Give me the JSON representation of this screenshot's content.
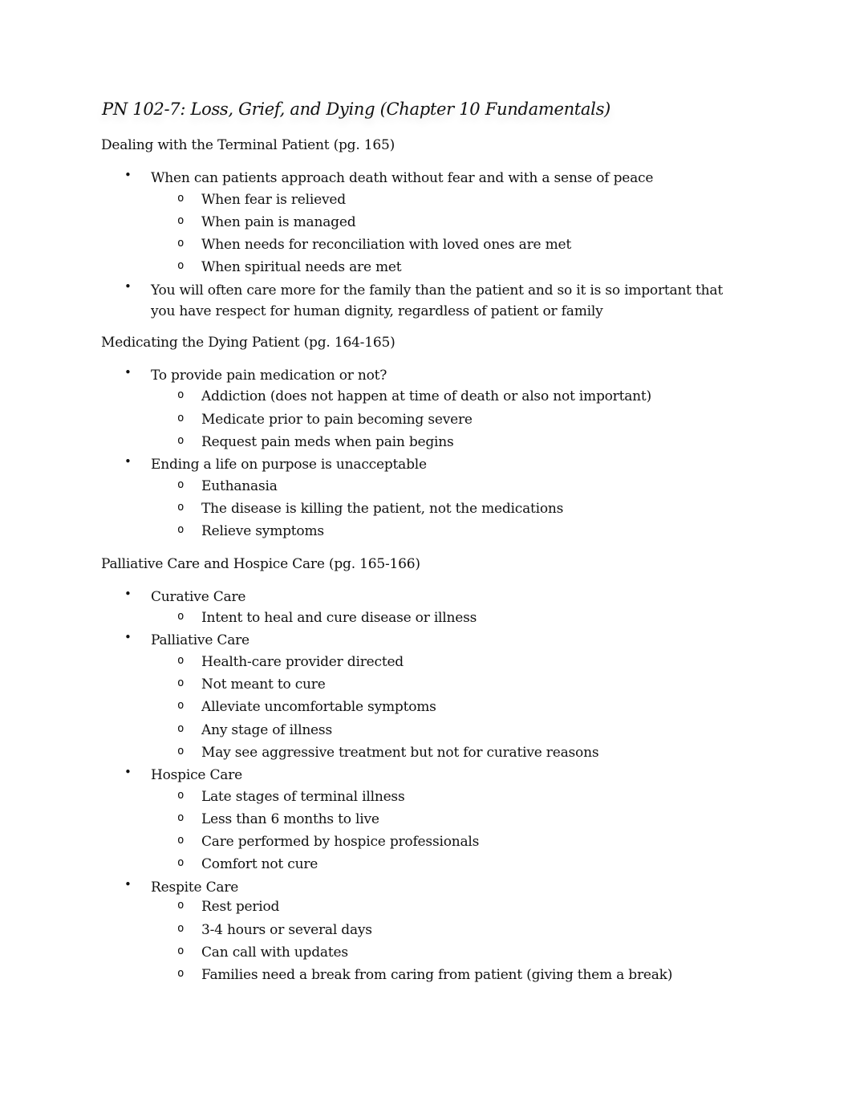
{
  "document": {
    "title": "PN 102-7: Loss, Grief, and Dying (Chapter 10 Fundamentals)",
    "bullet_glyph": "•",
    "sub_bullet_glyph": "o",
    "sections": [
      {
        "heading": "Dealing with the Terminal Patient (pg. 165)",
        "items": [
          {
            "text": "When can patients approach death without fear and with a sense of peace",
            "subitems": [
              "When fear is relieved",
              "When pain is managed",
              "When needs for reconciliation with loved ones are met",
              "When spiritual needs are met"
            ]
          },
          {
            "text_line1": "You will often care more for the family than the patient and so it is so important that",
            "text_line2": "you have respect for human dignity, regardless of patient or family",
            "subitems": []
          }
        ]
      },
      {
        "heading": "Medicating the Dying Patient (pg. 164-165)",
        "items": [
          {
            "text": "To provide pain medication or not?",
            "subitems": [
              "Addiction (does not happen at time of death or also not important)",
              "Medicate prior to pain becoming severe",
              "Request pain meds when pain begins"
            ]
          },
          {
            "text": "Ending a life on purpose is unacceptable",
            "subitems": [
              "Euthanasia",
              "The disease is killing the patient, not the medications",
              "Relieve symptoms"
            ]
          }
        ]
      },
      {
        "heading": "Palliative Care and Hospice Care (pg. 165-166)",
        "items": [
          {
            "text": "Curative Care",
            "subitems": [
              "Intent to heal and cure disease or illness"
            ]
          },
          {
            "text": "Palliative Care",
            "subitems": [
              "Health-care provider directed",
              "Not meant to cure",
              "Alleviate uncomfortable symptoms",
              "Any stage of illness",
              "May see aggressive treatment but not for curative reasons"
            ]
          },
          {
            "text": "Hospice Care",
            "subitems": [
              "Late stages of terminal illness",
              "Less than 6 months to live",
              "Care performed by hospice professionals",
              "Comfort not cure"
            ]
          },
          {
            "text": "Respite Care",
            "subitems": [
              "Rest period",
              "3-4 hours or several days",
              "Can call with updates",
              "Families need a break from caring from patient (giving them a break)"
            ]
          }
        ]
      }
    ]
  }
}
